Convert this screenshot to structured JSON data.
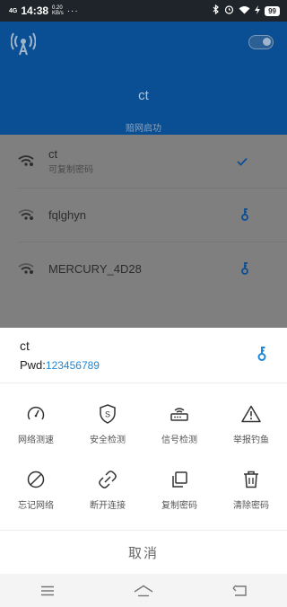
{
  "status_bar": {
    "network": "4G",
    "time": "14:38",
    "speed_value": "0.20",
    "speed_unit": "KB/s",
    "dots": "···",
    "battery": "99"
  },
  "header": {
    "ssid": "ct",
    "status": "赔网启功"
  },
  "networks": [
    {
      "name": "ct",
      "subtitle": "可复制密码",
      "connected": true
    },
    {
      "name": "fqlghyn",
      "subtitle": "",
      "connected": false
    },
    {
      "name": "MERCURY_4D28",
      "subtitle": "",
      "connected": false
    }
  ],
  "sheet": {
    "ssid": "ct",
    "pwd_label": "Pwd:",
    "pwd_value": "123456789",
    "actions_row1": [
      "网络测速",
      "安全检测",
      "信号检测",
      "举报钓鱼"
    ],
    "actions_row2": [
      "忘记网络",
      "断开连接",
      "复制密码",
      "清除密码"
    ],
    "cancel": "取消"
  },
  "colors": {
    "accent": "#2086d6",
    "header_bg": "#0a4f93",
    "overlay_bg": "#7f7f7f"
  }
}
